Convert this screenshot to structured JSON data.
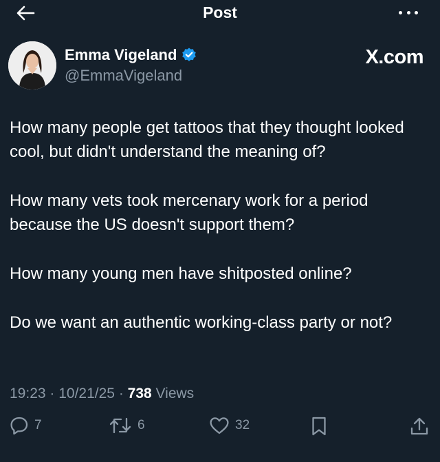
{
  "header": {
    "title": "Post"
  },
  "author": {
    "name": "Emma Vigeland",
    "handle": "@EmmaVigeland",
    "verified_color": "#1d9bf0"
  },
  "source_mark": "X.com",
  "post": {
    "paragraphs": [
      "How many people get tattoos that they thought looked cool, but didn't understand the meaning of?",
      "How many vets took mercenary work for a period because the US doesn't support them?",
      "How many young men have shitposted online?",
      "Do we want an authentic working-class party or not?"
    ]
  },
  "meta": {
    "time": "19:23",
    "date": "10/21/25",
    "views_count": "738",
    "views_label": "Views"
  },
  "actions": {
    "replies": "7",
    "reposts": "6",
    "likes": "32"
  },
  "colors": {
    "background": "#15202b",
    "text": "#ffffff",
    "muted": "#8b98a5",
    "accent": "#1d9bf0"
  },
  "icons": [
    "back-arrow-icon",
    "more-icon",
    "verified-badge-icon",
    "reply-icon",
    "repost-icon",
    "like-icon",
    "bookmark-icon",
    "share-icon"
  ]
}
